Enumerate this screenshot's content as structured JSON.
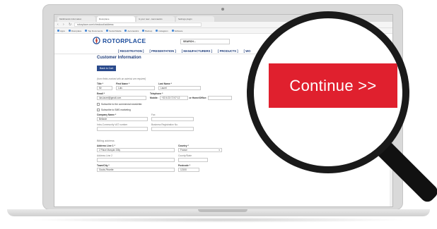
{
  "browser": {
    "tabs": [
      "Multibrands Information",
      "Rotorplace",
      "Is your new - Aeronautics",
      "Settings plugin"
    ],
    "address": "rotorplace.com/checkout/address",
    "bookmarks": [
      "Apps",
      "Rotorplace",
      "Top Documents",
      "Social Media",
      "Aeronautics",
      "Backup",
      "Instagram",
      "Software"
    ]
  },
  "site": {
    "logo": "ROTORPLACE",
    "logo_sub": "by",
    "search_placeholder": "SEARCH...",
    "menu": [
      "[ REGISTRATION ]",
      "[ PRESENTATION ]",
      "[ MANUFACTURERS ]",
      "[ PRODUCTS ]",
      "[ WO"
    ]
  },
  "form": {
    "title": "Customer Information",
    "back_button": "Back to Cart",
    "note": "(form fields marked with an asterisk are required)",
    "title_label": "Title *",
    "title_value": "Mr",
    "first_name_label": "First Name *",
    "first_name_value": "Luis",
    "last_name_label": "Last Name *",
    "last_name_value": "Laurel",
    "email_label": "Email *",
    "email_value": "luis.laurel@gmail.com",
    "telephone_label": "Telephone *",
    "mobile_label": "Mobile:",
    "mobile_value": "+33 6 23 72 07 12",
    "home_office_label": "or Home/Office:",
    "subscribe_newsletter": "Subscribe to the commercial newsletter.",
    "subscribe_sms": "Subscribe to SMS marketing",
    "company_label": "Company Name *",
    "company_value": "Bellavie",
    "fax_label": "Fax",
    "vat_label": "Intra-Community VAT number",
    "business_reg_label": "Business Registration No.",
    "billing_title": "Billing address",
    "address1_label": "Address Line 1 *",
    "address1_value": "2 Place Marquis Gilly",
    "country_label": "Country *",
    "country_value": "France",
    "address2_label": "Address Line 2",
    "county_label": "County/State",
    "town_label": "Town/City *",
    "town_value": "Gouts-Piroette",
    "postcode_label": "Postcode *",
    "postcode_value": "12100"
  },
  "magnifier": {
    "continue_label": "Continue >>"
  },
  "colors": {
    "continue_button": "#e0202e",
    "brand_blue": "#1f4e9c",
    "lens_frame": "#1a1a1a"
  }
}
